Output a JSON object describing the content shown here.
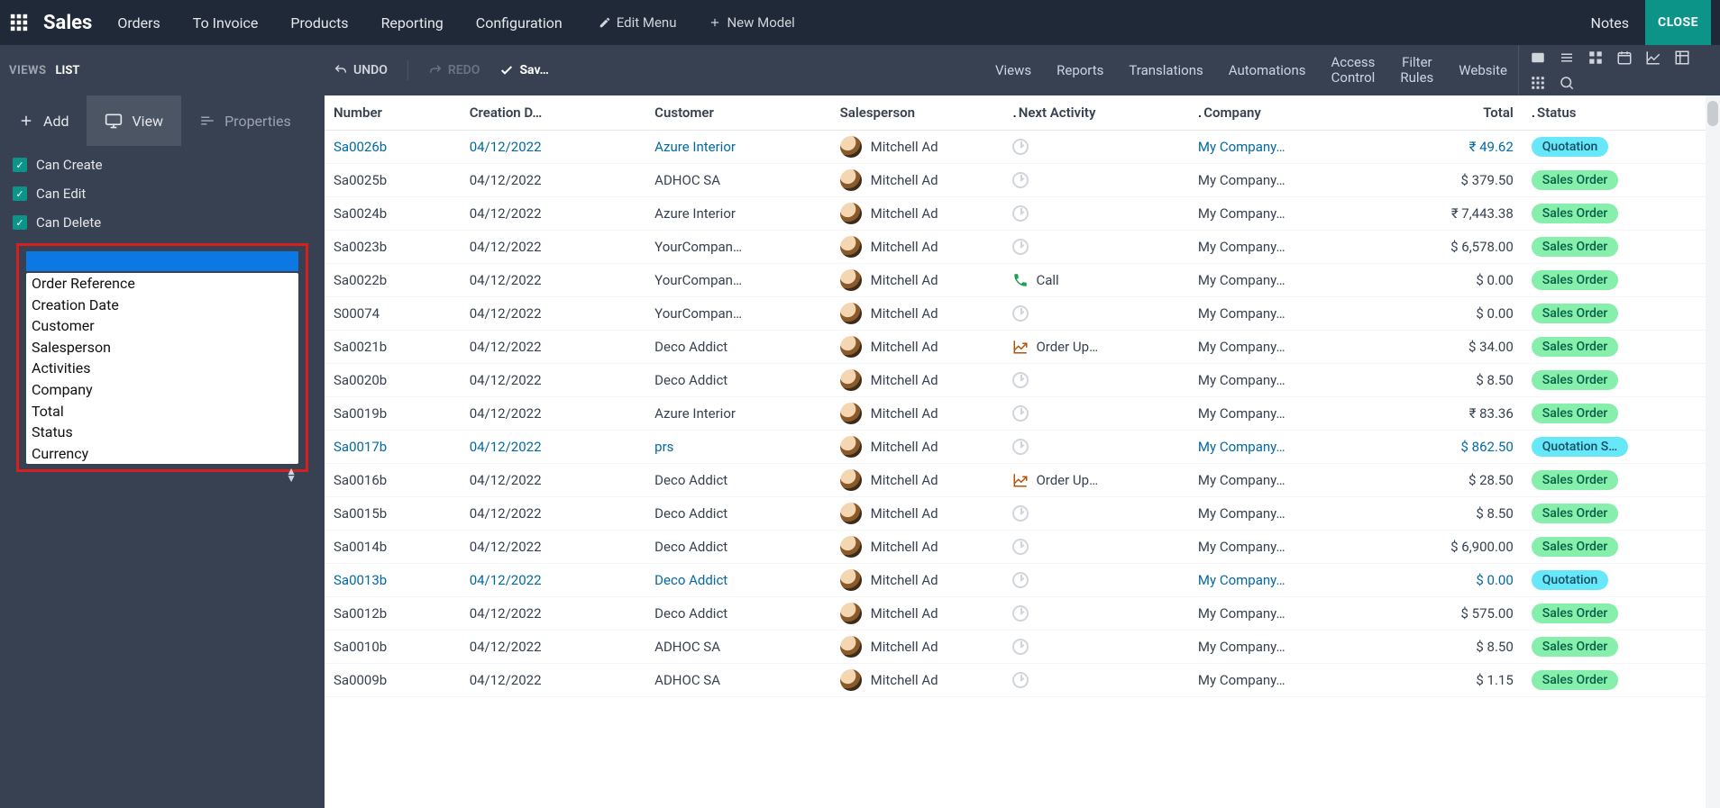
{
  "navbar": {
    "app_title": "Sales",
    "menu": [
      "Orders",
      "To Invoice",
      "Products",
      "Reporting",
      "Configuration"
    ],
    "edit_menu": "Edit Menu",
    "new_model": "New Model",
    "notes": "Notes",
    "close": "CLOSE"
  },
  "subbar": {
    "views_label": "VIEWS",
    "list_label": "LIST",
    "undo": "UNDO",
    "redo": "REDO",
    "save": "Sav…",
    "tabs": [
      "Views",
      "Reports",
      "Translations",
      "Automations"
    ],
    "access_control": "Access Control",
    "filter_rules": "Filter Rules",
    "website": "Website"
  },
  "sidebar": {
    "tabs": {
      "add": "Add",
      "view": "View",
      "properties": "Properties"
    },
    "can_create": "Can Create",
    "can_edit": "Can Edit",
    "can_delete": "Can Delete",
    "combo_options": [
      "Order Reference",
      "Creation Date",
      "Customer",
      "Salesperson",
      "Activities",
      "Company",
      "Total",
      "Status",
      "Currency"
    ]
  },
  "table": {
    "columns": [
      "Number",
      "Creation D…",
      "Customer",
      "Salesperson",
      "Next Activity",
      "Company",
      "Total",
      "Status"
    ],
    "rows": [
      {
        "num": "Sa0026b",
        "date": "04/12/2022",
        "cust": "Azure Interior",
        "sp": "Mitchell Ad",
        "act": "",
        "act_icon": "clock",
        "comp": "My Company…",
        "tot": "₹ 49.62",
        "stat": "Quotation",
        "link": true
      },
      {
        "num": "Sa0025b",
        "date": "04/12/2022",
        "cust": "ADHOC SA",
        "sp": "Mitchell Ad",
        "act": "",
        "act_icon": "clock",
        "comp": "My Company…",
        "tot": "$ 379.50",
        "stat": "Sales Order"
      },
      {
        "num": "Sa0024b",
        "date": "04/12/2022",
        "cust": "Azure Interior",
        "sp": "Mitchell Ad",
        "act": "",
        "act_icon": "clock",
        "comp": "My Company…",
        "tot": "₹ 7,443.38",
        "stat": "Sales Order"
      },
      {
        "num": "Sa0023b",
        "date": "04/12/2022",
        "cust": "YourCompan…",
        "sp": "Mitchell Ad",
        "act": "",
        "act_icon": "clock",
        "comp": "My Company…",
        "tot": "$ 6,578.00",
        "stat": "Sales Order"
      },
      {
        "num": "Sa0022b",
        "date": "04/12/2022",
        "cust": "YourCompan…",
        "sp": "Mitchell Ad",
        "act": "Call",
        "act_icon": "call",
        "comp": "My Company…",
        "tot": "$ 0.00",
        "stat": "Sales Order"
      },
      {
        "num": "S00074",
        "date": "04/12/2022",
        "cust": "YourCompan…",
        "sp": "Mitchell Ad",
        "act": "",
        "act_icon": "clock",
        "comp": "My Company…",
        "tot": "$ 0.00",
        "stat": "Sales Order"
      },
      {
        "num": "Sa0021b",
        "date": "04/12/2022",
        "cust": "Deco Addict",
        "sp": "Mitchell Ad",
        "act": "Order Up…",
        "act_icon": "chart",
        "comp": "My Company…",
        "tot": "$ 34.00",
        "stat": "Sales Order"
      },
      {
        "num": "Sa0020b",
        "date": "04/12/2022",
        "cust": "Deco Addict",
        "sp": "Mitchell Ad",
        "act": "",
        "act_icon": "clock",
        "comp": "My Company…",
        "tot": "$ 8.50",
        "stat": "Sales Order"
      },
      {
        "num": "Sa0019b",
        "date": "04/12/2022",
        "cust": "Azure Interior",
        "sp": "Mitchell Ad",
        "act": "",
        "act_icon": "clock",
        "comp": "My Company…",
        "tot": "₹ 83.36",
        "stat": "Sales Order"
      },
      {
        "num": "Sa0017b",
        "date": "04/12/2022",
        "cust": "prs",
        "sp": "Mitchell Ad",
        "act": "",
        "act_icon": "clock",
        "comp": "My Company…",
        "tot": "$ 862.50",
        "stat": "Quotation S…",
        "link": true
      },
      {
        "num": "Sa0016b",
        "date": "04/12/2022",
        "cust": "Deco Addict",
        "sp": "Mitchell Ad",
        "act": "Order Up…",
        "act_icon": "chart",
        "comp": "My Company…",
        "tot": "$ 28.50",
        "stat": "Sales Order"
      },
      {
        "num": "Sa0015b",
        "date": "04/12/2022",
        "cust": "Deco Addict",
        "sp": "Mitchell Ad",
        "act": "",
        "act_icon": "clock",
        "comp": "My Company…",
        "tot": "$ 8.50",
        "stat": "Sales Order"
      },
      {
        "num": "Sa0014b",
        "date": "04/12/2022",
        "cust": "Deco Addict",
        "sp": "Mitchell Ad",
        "act": "",
        "act_icon": "clock",
        "comp": "My Company…",
        "tot": "$ 6,900.00",
        "stat": "Sales Order"
      },
      {
        "num": "Sa0013b",
        "date": "04/12/2022",
        "cust": "Deco Addict",
        "sp": "Mitchell Ad",
        "act": "",
        "act_icon": "clock",
        "comp": "My Company…",
        "tot": "$ 0.00",
        "stat": "Quotation",
        "link": true
      },
      {
        "num": "Sa0012b",
        "date": "04/12/2022",
        "cust": "Deco Addict",
        "sp": "Mitchell Ad",
        "act": "",
        "act_icon": "clock",
        "comp": "My Company…",
        "tot": "$ 575.00",
        "stat": "Sales Order"
      },
      {
        "num": "Sa0010b",
        "date": "04/12/2022",
        "cust": "ADHOC SA",
        "sp": "Mitchell Ad",
        "act": "",
        "act_icon": "clock",
        "comp": "My Company…",
        "tot": "$ 8.50",
        "stat": "Sales Order"
      },
      {
        "num": "Sa0009b",
        "date": "04/12/2022",
        "cust": "ADHOC SA",
        "sp": "Mitchell Ad",
        "act": "",
        "act_icon": "clock",
        "comp": "My Company…",
        "tot": "$ 1.15",
        "stat": "Sales Order"
      }
    ]
  }
}
